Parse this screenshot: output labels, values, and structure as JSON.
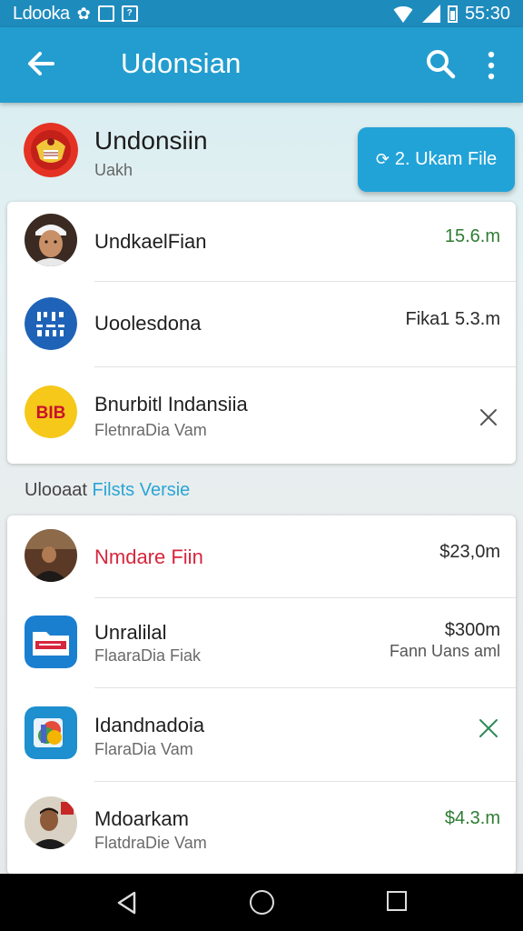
{
  "status_bar": {
    "app_name": "Ldooka",
    "time": "55:30",
    "icons": [
      "gallery-icon",
      "image-icon",
      "notification-icon",
      "wifi-icon",
      "signal-icon",
      "battery-icon"
    ]
  },
  "app_bar": {
    "title": "Udonsian",
    "back_icon": "back-arrow-icon",
    "search_icon": "search-icon",
    "more_icon": "more-vert-icon",
    "color": "#239dcf"
  },
  "header": {
    "title": "Undonsiin",
    "subtitle": "Uakh",
    "upload_button": {
      "icon": "upload-icon",
      "label": "2. Ukam File"
    }
  },
  "section_one": {
    "items": [
      {
        "title": "UndkaelFian",
        "value": "15.6.m",
        "value_color": "#2e7d32"
      },
      {
        "title": "Uoolesdona",
        "value": "Fika1 5.3.m"
      },
      {
        "title": "Bnurbitl Indansiia",
        "subtitle": "FletnraDia Vam",
        "action": "close-icon"
      }
    ]
  },
  "section_label": {
    "prefix": "Ulooaat",
    "accent": "Filsts Versie"
  },
  "section_two": {
    "items": [
      {
        "title": "Nmdare Fiin",
        "title_color": "#d7263d",
        "value": "$23,0m"
      },
      {
        "title": "Unralilal",
        "subtitle": "FlaaraDia Fiak",
        "value": "$300m",
        "value2": "Fann Uans aml"
      },
      {
        "title": "Idandnadoia",
        "subtitle": "FlaraDia Vam",
        "action": "close-icon"
      },
      {
        "title": "Mdoarkam",
        "subtitle": "FlatdraDie Vam",
        "value": "$4.3.m",
        "value_color": "#2e7d32"
      }
    ]
  },
  "nav_bar": {
    "icons": [
      "nav-back-icon",
      "nav-home-icon",
      "nav-recents-icon"
    ]
  }
}
